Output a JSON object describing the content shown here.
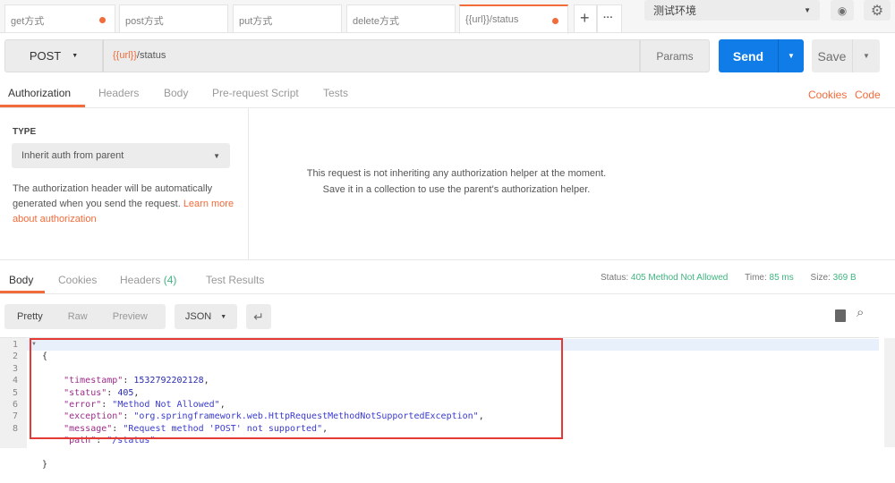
{
  "tabs": [
    {
      "label": "get方式",
      "dot": true
    },
    {
      "label": "post方式",
      "dot": false
    },
    {
      "label": "put方式",
      "dot": false
    },
    {
      "label": "delete方式",
      "dot": false
    },
    {
      "label": "{{url}}/status",
      "dot": true
    }
  ],
  "environment": "测试环境",
  "request": {
    "method": "POST",
    "url_var": "{{url}}",
    "url_path": "/status",
    "params": "Params",
    "send": "Send",
    "save": "Save"
  },
  "req_tabs": [
    "Authorization",
    "Headers",
    "Body",
    "Pre-request Script",
    "Tests"
  ],
  "links": {
    "cookies": "Cookies",
    "code": "Code"
  },
  "auth": {
    "type_label": "TYPE",
    "type_value": "Inherit auth from parent",
    "desc": "The authorization header will be automatically generated when you send the request. ",
    "learn_more": "Learn more about authorization",
    "message": "This request is not inheriting any authorization helper at the moment. Save it in a collection to use the parent's authorization helper."
  },
  "resp_tabs": {
    "body": "Body",
    "cookies": "Cookies",
    "headers": "Headers",
    "headers_count": "(4)",
    "tests": "Test Results"
  },
  "status": {
    "status_label": "Status:",
    "status_value": "405 Method Not Allowed",
    "time_label": "Time:",
    "time_value": "85 ms",
    "size_label": "Size:",
    "size_value": "369 B"
  },
  "view": {
    "pretty": "Pretty",
    "raw": "Raw",
    "preview": "Preview",
    "format": "JSON"
  },
  "lines": [
    "1",
    "2",
    "3",
    "4",
    "5",
    "6",
    "7",
    "8"
  ],
  "json": {
    "open": "{",
    "close": "}",
    "fields": [
      {
        "k": "\"timestamp\"",
        "v": "1532792202128",
        "t": "n",
        "c": ","
      },
      {
        "k": "\"status\"",
        "v": "405",
        "t": "n",
        "c": ","
      },
      {
        "k": "\"error\"",
        "v": "\"Method Not Allowed\"",
        "t": "s",
        "c": ","
      },
      {
        "k": "\"exception\"",
        "v": "\"org.springframework.web.HttpRequestMethodNotSupportedException\"",
        "t": "s",
        "c": ","
      },
      {
        "k": "\"message\"",
        "v": "\"Request method 'POST' not supported\"",
        "t": "s",
        "c": ","
      },
      {
        "k": "\"path\"",
        "v": "\"/status\"",
        "t": "s",
        "c": ""
      }
    ]
  },
  "colors": {
    "accent": "#f26b3a",
    "send": "#0f7ce8",
    "status": "#3fb47f",
    "highlight": "#e53935"
  }
}
